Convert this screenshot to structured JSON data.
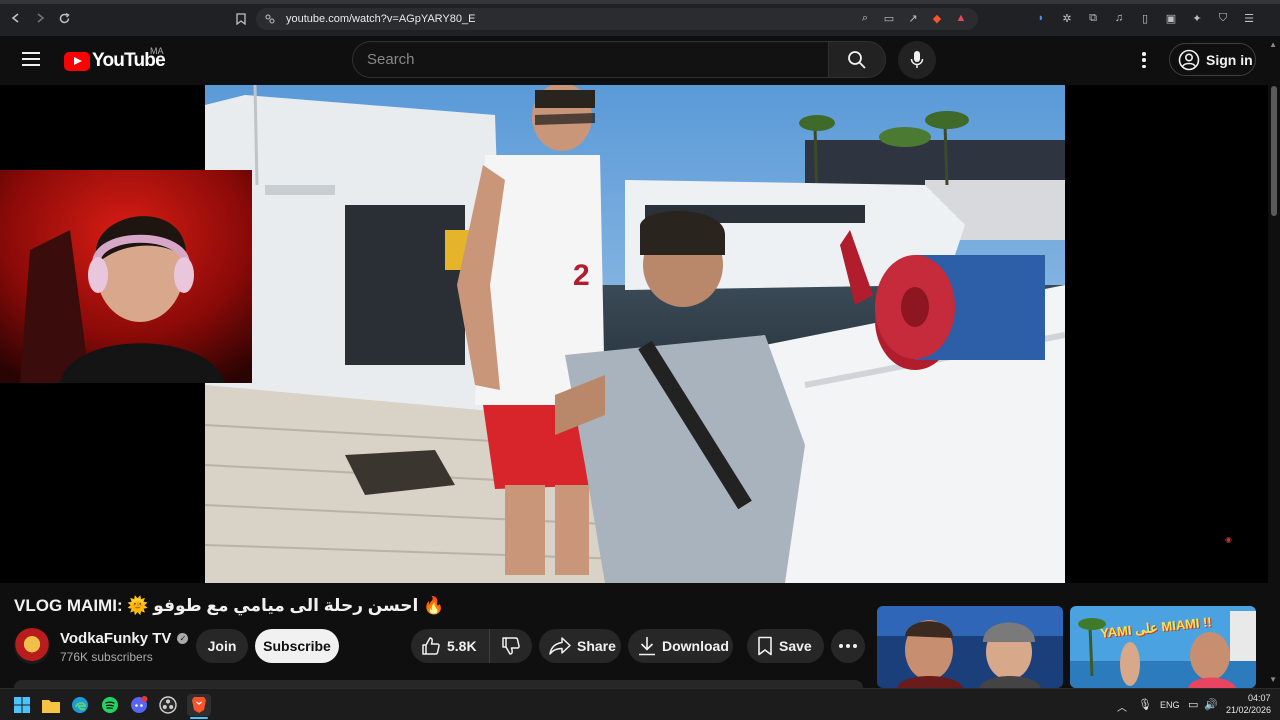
{
  "browser": {
    "url": "youtube.com/watch?v=AGpYARY80_E"
  },
  "header": {
    "logo_text": "YouTube",
    "region": "MA",
    "search_placeholder": "Search",
    "signin_label": "Sign in"
  },
  "video": {
    "title": "VLOG MAIMI: 🌞 احسن رحلة الى ميامي مع طوفو 🔥",
    "channel_name": "VodkaFunky TV",
    "subscribers": "776K subscribers",
    "join_label": "Join",
    "subscribe_label": "Subscribe",
    "likes": "5.8K",
    "share_label": "Share",
    "download_label": "Download",
    "save_label": "Save"
  },
  "suggestions": [
    {
      "thumb_text": ""
    },
    {
      "thumb_text": "YAMI على MIAMI !!"
    }
  ],
  "taskbar": {
    "language": "ENG",
    "time": "04:07",
    "date": "21/02/2026"
  },
  "colors": {
    "accent_red": "#ff0000",
    "background": "#0f0f0f",
    "pill": "#272727"
  }
}
